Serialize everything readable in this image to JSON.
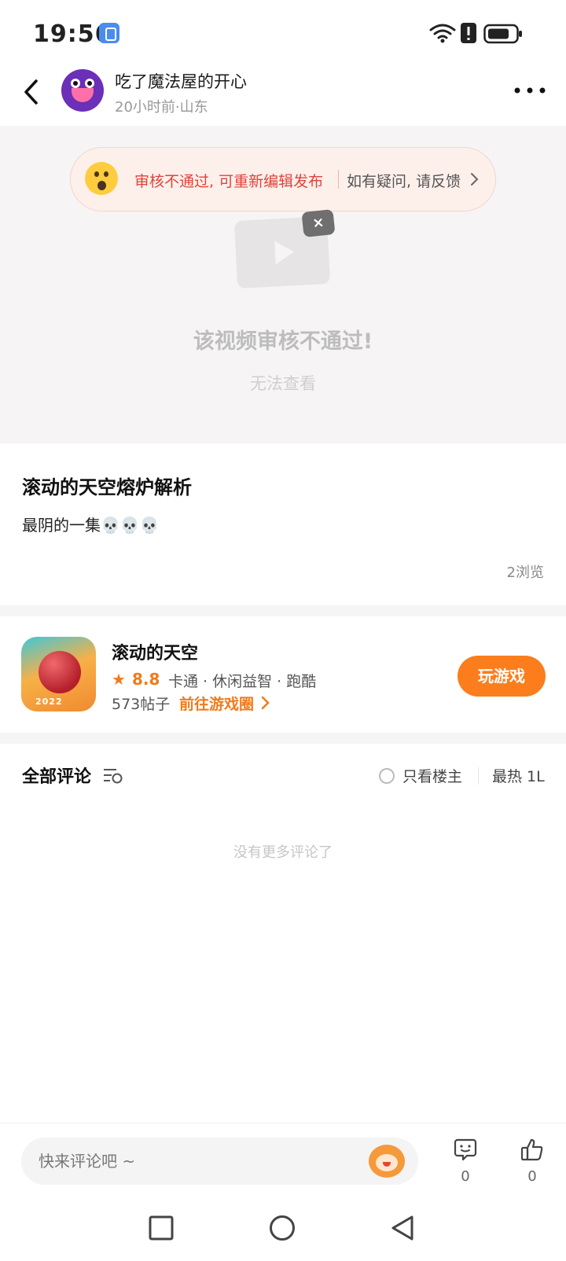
{
  "status_bar": {
    "time": "19:56"
  },
  "header": {
    "username": "吃了魔法屋的开心",
    "meta": "20小时前·山东"
  },
  "review_banner": {
    "message": "审核不通过, 可重新编辑发布",
    "feedback": "如有疑问, 请反馈"
  },
  "video": {
    "rejected_title": "该视频审核不通过!",
    "rejected_subtitle": "无法查看"
  },
  "post": {
    "title": "滚动的天空熔炉解析",
    "body": "最阴的一集💀💀💀",
    "views": "2浏览"
  },
  "game_card": {
    "name": "滚动的天空",
    "rating": "8.8",
    "tags": "卡通 · 休闲益智 · 跑酷",
    "posts": "573帖子",
    "link": "前往游戏圈",
    "play_label": "玩游戏",
    "icon_year": "2022"
  },
  "comments": {
    "title": "全部评论",
    "owner_only": "只看楼主",
    "sort": "最热 1L",
    "empty": "没有更多评论了"
  },
  "bottom_bar": {
    "placeholder": "快来评论吧 ~",
    "comment_count": "0",
    "like_count": "0"
  },
  "colors": {
    "accent": "#fb7d1b",
    "alert_red": "#e0433a",
    "banner_bg": "#fdf0eb"
  }
}
